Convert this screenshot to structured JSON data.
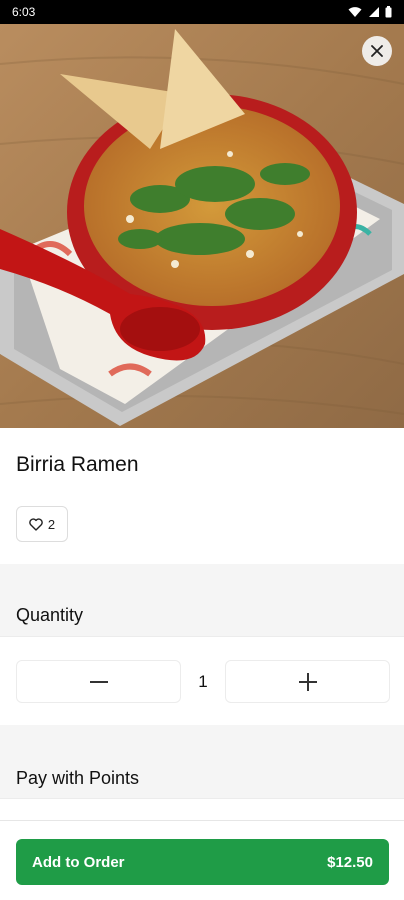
{
  "status_bar": {
    "time": "6:03"
  },
  "item": {
    "name": "Birria Ramen",
    "likes": "2"
  },
  "sections": {
    "quantity_title": "Quantity",
    "points_title": "Pay with Points"
  },
  "quantity": {
    "value": "1"
  },
  "cta": {
    "label": "Add to Order",
    "price": "$12.50"
  },
  "colors": {
    "accent": "#1f9c47",
    "section_bg": "#f5f5f5"
  },
  "icons": [
    "wifi-icon",
    "signal-icon",
    "battery-icon",
    "close-icon",
    "heart-icon",
    "minus-icon",
    "plus-icon"
  ]
}
